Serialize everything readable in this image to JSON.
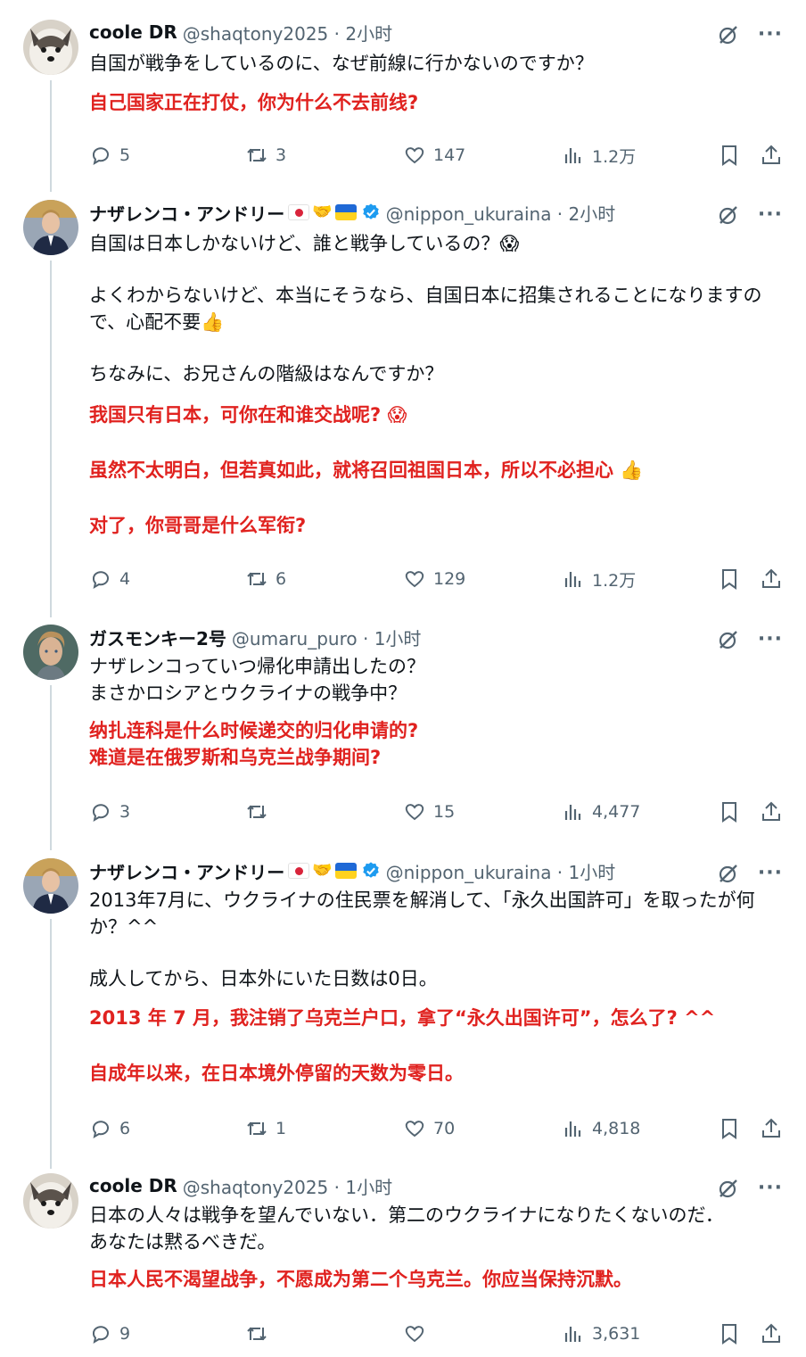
{
  "posts": [
    {
      "name": "coole DR",
      "handle": "@shaqtony2025 · 2小时",
      "jp": [
        "自国が戦争をしているのに、なぜ前線に行かないのですか？"
      ],
      "cn": [
        "自己国家正在打仗，你为什么不去前线?"
      ],
      "stats": {
        "replies": "5",
        "reposts": "3",
        "likes": "147",
        "views": "1.2万"
      }
    },
    {
      "name": "ナザレンコ・アンドリー",
      "handle": "@nippon_ukuraina · 2小时",
      "jp": [
        "自国は日本しかないけど、誰と戦争しているの？😱",
        "よくわからないけど、本当にそうなら、自国日本に招集されることになりますので、心配不要👍",
        "ちなみに、お兄さんの階級はなんですか？"
      ],
      "cn": [
        "我国只有日本，可你在和谁交战呢? 😱",
        "虽然不太明白，但若真如此，就将召回祖国日本，所以不必担心 👍",
        "对了，你哥哥是什么军衔?"
      ],
      "stats": {
        "replies": "4",
        "reposts": "6",
        "likes": "129",
        "views": "1.2万"
      }
    },
    {
      "name": "ガスモンキー2号",
      "handle": "@umaru_puro · 1小时",
      "jp": [
        "ナザレンコっていつ帰化申請出したの？",
        "まさかロシアとウクライナの戦争中？"
      ],
      "cn": [
        "纳扎连科是什么时候递交的归化申请的?",
        "难道是在俄罗斯和乌克兰战争期间?"
      ],
      "stats": {
        "replies": "3",
        "reposts": "",
        "likes": "15",
        "views": "4,477"
      }
    },
    {
      "name": "ナザレンコ・アンドリー",
      "handle": "@nippon_ukuraina · 1小时",
      "jp": [
        "2013年7月に、ウクライナの住民票を解消して、「永久出国許可」を取ったが何か？^^",
        "成人してから、日本外にいた日数は0日。"
      ],
      "cn": [
        "2013 年 7 月，我注销了乌克兰户口，拿了“永久出国许可”，怎么了? ^^",
        "自成年以来，在日本境外停留的天数为零日。"
      ],
      "stats": {
        "replies": "6",
        "reposts": "1",
        "likes": "70",
        "views": "4,818"
      }
    },
    {
      "name": "coole DR",
      "handle": "@shaqtony2025 · 1小时",
      "jp": [
        "日本の人々は戦争を望んでいない．第二のウクライナになりたくないのだ．",
        "あなたは黙るべきだ。"
      ],
      "cn": [
        "日本人民不渴望战争，不愿成为第二个乌克兰。你应当保持沉默。"
      ],
      "stats": {
        "replies": "9",
        "reposts": "",
        "likes": "",
        "views": "3,631"
      }
    }
  ],
  "icons": {
    "reply": "reply-icon",
    "repost": "repost-icon",
    "like": "heart-icon",
    "views": "views-icon",
    "bookmark": "bookmark-icon",
    "share": "share-icon",
    "grok": "grok-icon",
    "more": "more-icon",
    "verified": "verified-badge-icon"
  },
  "colors": {
    "translation": "#e0221f",
    "muted": "#536471",
    "verified": "#1d9bf0",
    "thread_line": "#cfd9de"
  }
}
